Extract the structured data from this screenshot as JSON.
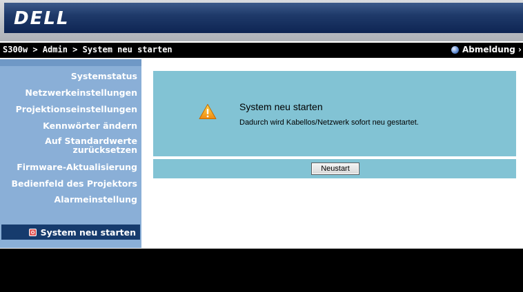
{
  "header": {
    "logo": "DELL"
  },
  "breadcrumb": {
    "path": "S300w > Admin > System neu starten"
  },
  "logout": {
    "label": "Abmeldung ›",
    "icon": "globe-icon"
  },
  "sidebar": {
    "items": [
      {
        "label": "Systemstatus"
      },
      {
        "label": "Netzwerkeinstellungen"
      },
      {
        "label": "Projektionseinstellungen"
      },
      {
        "label": "Kennwörter ändern"
      },
      {
        "label": "Auf Standardwerte"
      },
      {
        "label": "zurücksetzen"
      },
      {
        "label": "Firmware-Aktualisierung"
      },
      {
        "label": "Bedienfeld des Projektors"
      },
      {
        "label": "Alarmeinstellung"
      }
    ],
    "active": {
      "label": "System neu starten",
      "icon": "power-icon"
    }
  },
  "content": {
    "title": "System neu starten",
    "description": "Dadurch wird Kabellos/Netzwerk sofort neu gestartet.",
    "warning_icon": "warning-icon",
    "button_label": "Neustart"
  },
  "colors": {
    "sidebar_bg": "#8aafd7",
    "active_item_bg": "#163b6d",
    "panel_bg": "#82c3d4",
    "header_strip": "#1f3a6a"
  }
}
